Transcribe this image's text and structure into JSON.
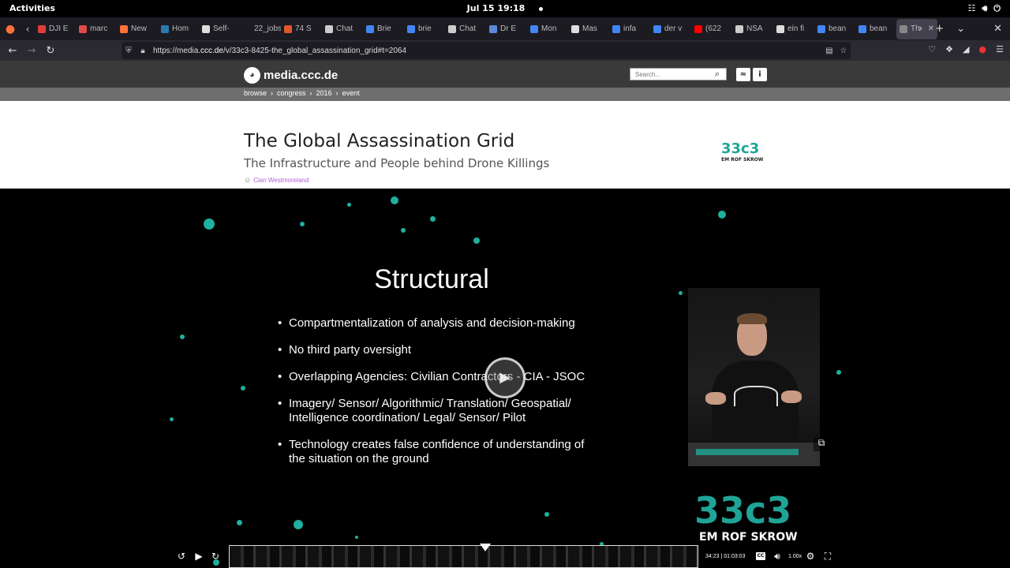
{
  "system_bar": {
    "activities": "Activities",
    "clock": "Jul 15  19:18"
  },
  "browser": {
    "tabs": [
      {
        "label": "DJI E",
        "color": "#e03c3c"
      },
      {
        "label": "marc",
        "color": "#e04a4a"
      },
      {
        "label": "New",
        "color": "#ff7139"
      },
      {
        "label": "Hom",
        "color": "#2a7ab0"
      },
      {
        "label": "Self-",
        "color": "#dddddd"
      },
      {
        "label": "22_jobs",
        "color": "#1c1b22"
      },
      {
        "label": "74 S",
        "color": "#e0582a"
      },
      {
        "label": "Chat",
        "color": "#cccccc"
      },
      {
        "label": "Brie",
        "color": "#4285f4"
      },
      {
        "label": "brie",
        "color": "#4285f4"
      },
      {
        "label": "Chat",
        "color": "#cccccc"
      },
      {
        "label": "Dr E",
        "color": "#5a8ad8"
      },
      {
        "label": "Mon",
        "color": "#4285f4"
      },
      {
        "label": "Mas",
        "color": "#dddddd"
      },
      {
        "label": "infa",
        "color": "#4285f4"
      },
      {
        "label": "der v",
        "color": "#4285f4"
      },
      {
        "label": "(622",
        "color": "#ff0000"
      },
      {
        "label": "NSA",
        "color": "#cccccc"
      },
      {
        "label": "ein fi",
        "color": "#dddddd"
      },
      {
        "label": "bean",
        "color": "#4285f4"
      },
      {
        "label": "bean",
        "color": "#4285f4"
      },
      {
        "label": "Th",
        "color": "#888888",
        "active": true
      }
    ],
    "url_prefix": "https://media.",
    "url_domain": "ccc.de",
    "url_suffix": "/v/33c3-8425-the_global_assassination_grid#t=2064"
  },
  "site": {
    "logo_text": "media.ccc.de",
    "search_placeholder": "Search...",
    "breadcrumbs": [
      "browse",
      "›",
      "congress",
      "›",
      "2016",
      "›",
      "event"
    ]
  },
  "talk": {
    "title": "The Global Assassination Grid",
    "subtitle": "The Infrastructure and People behind Drone Killings",
    "speaker": "Cian Westmoreland",
    "conference_logo_text": "33c3",
    "conference_logo_sub": "EM ROF SKROW"
  },
  "slide": {
    "title": "Structural",
    "bullets": [
      "Compartmentalization of analysis and decision-making",
      "No third party oversight",
      "Overlapping Agencies: Civilian Contractors - CIA - JSOC",
      "Imagery/ Sensor/ Algorithmic/ Translation/ Geospatial/ Intelligence coordination/ Legal/ Sensor/ Pilot",
      "Technology creates false confidence of understanding of the situation on the ground"
    ],
    "logo_text": "33c3",
    "logo_sub": "EM ROF SKROW"
  },
  "player": {
    "time": "34:23 | 01:03:03",
    "cc_label": "CC",
    "speed": "1.00x",
    "progress_fraction": 0.545
  }
}
